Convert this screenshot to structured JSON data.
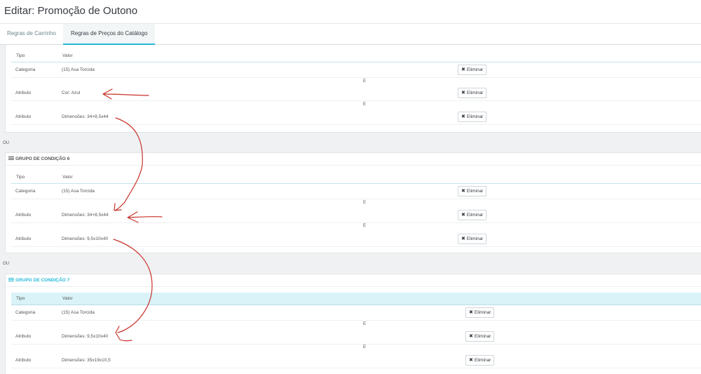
{
  "header": {
    "title": "Editar: Promoção de Outono"
  },
  "tabs": [
    {
      "label": "Regras de Carrinho"
    },
    {
      "label": "Regras de Preços do Catálogo"
    }
  ],
  "table_headers": {
    "type": "Tipo",
    "value": "Valor"
  },
  "and_label": "E",
  "or_label": "OU",
  "delete_label": "Eliminar",
  "groups": [
    {
      "title": "",
      "rows": [
        {
          "type": "Categoria",
          "value": "(15) Asa Torcida"
        },
        {
          "type": "Atributo",
          "value": "Cor: Azul"
        },
        {
          "type": "Atributo",
          "value": "Dimensões: 34+8,5x44"
        }
      ]
    },
    {
      "title": "GRUPO DE CONDIÇÃO 6",
      "rows": [
        {
          "type": "Categoria",
          "value": "(15) Asa Torcida"
        },
        {
          "type": "Atributo",
          "value": "Dimensões: 34+8,5x44"
        },
        {
          "type": "Atributo",
          "value": "Dimensões: 9,5x10x40"
        }
      ]
    },
    {
      "title": "GRUPO DE CONDIÇÃO 7",
      "rows": [
        {
          "type": "Categoria",
          "value": "(15) Asa Torcida"
        },
        {
          "type": "Atributo",
          "value": "Dimensões: 9,5x10x40"
        },
        {
          "type": "Atributo",
          "value": "Dimensões: 35x19x10,5"
        }
      ]
    }
  ],
  "colors": {
    "accent": "#25b9d7",
    "annotation": "#c8322a"
  }
}
